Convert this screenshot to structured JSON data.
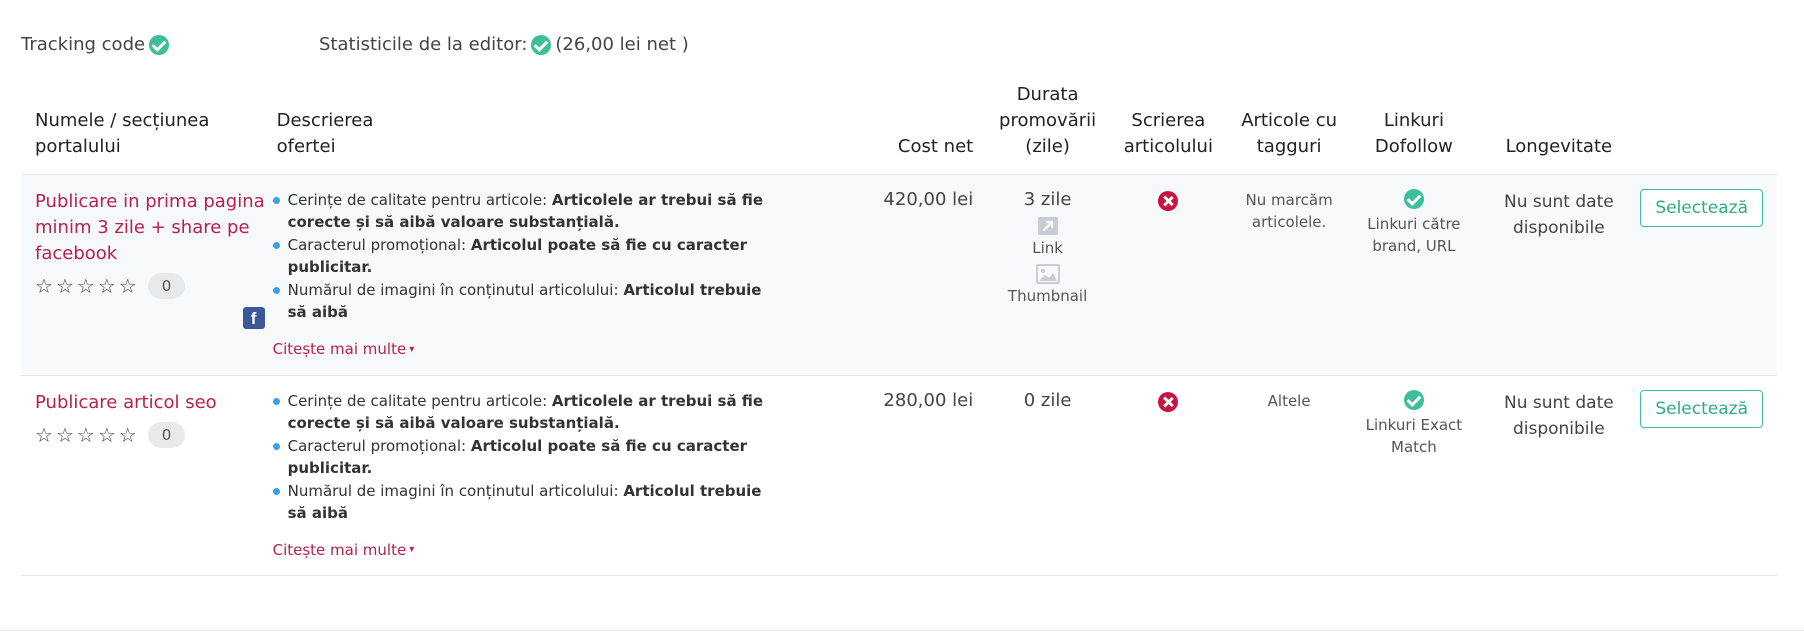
{
  "topbar": {
    "tracking_label": "Tracking code",
    "editor_stats_label": "Statisticile de la editor:",
    "editor_stats_value": "(26,00 lei net )"
  },
  "table": {
    "headers": {
      "name_l1": "Numele / secțiunea",
      "name_l2": "portalului",
      "desc_l1": "Descrierea",
      "desc_l2": "ofertei",
      "cost": "Cost net",
      "duration_l1": "Durata",
      "duration_l2": "promovării",
      "duration_l3": "(zile)",
      "writing_l1": "Scrierea",
      "writing_l2": "articolului",
      "tagged_l1": "Articole cu",
      "tagged_l2": "tagguri",
      "links_l1": "Linkuri",
      "links_l2": "Dofollow",
      "longevity": "Longevitate"
    },
    "rows": [
      {
        "portal_name": "Publicare in prima pagina minim 3 zile + share pe facebook",
        "rating_count": "0",
        "desc_1_label": "Cerințe de calitate pentru articole: ",
        "desc_1_value": "Articolele ar trebui să fie corecte și să aibă valoare substanțială.",
        "desc_2_label": "Caracterul promoțional: ",
        "desc_2_value": "Articolul poate să fie cu caracter publicitar.",
        "desc_3_label": "Numărul de imagini în conținutul articolului: ",
        "desc_3_value": "Articolul trebuie să aibă",
        "read_more": "Citește mai multe",
        "cost": "420,00 lei",
        "duration": "3 zile",
        "promo_link_label": "Link",
        "promo_thumb_label": "Thumbnail",
        "tagged": "Nu marcăm articolele.",
        "links": "Linkuri către brand, URL",
        "longevity": "Nu sunt date disponibile",
        "select_label": "Selectează"
      },
      {
        "portal_name": "Publicare articol seo",
        "rating_count": "0",
        "desc_1_label": "Cerințe de calitate pentru articole: ",
        "desc_1_value": "Articolele ar trebui să fie corecte și să aibă valoare substanțială.",
        "desc_2_label": "Caracterul promoțional: ",
        "desc_2_value": "Articolul poate să fie cu caracter publicitar.",
        "desc_3_label": "Numărul de imagini în conținutul articolului: ",
        "desc_3_value": "Articolul trebuie să aibă",
        "read_more": "Citește mai multe",
        "cost": "280,00 lei",
        "duration": "0 zile",
        "tagged": "Altele",
        "links": "Linkuri Exact Match",
        "longevity": "Nu sunt date disponibile",
        "select_label": "Selectează"
      }
    ]
  },
  "colors": {
    "link": "#b8204e",
    "success": "#3cbf9a",
    "error": "#c8153f",
    "bullet": "#3aa0e8",
    "facebook": "#3b5998"
  },
  "icons": {
    "tracking_status": "check-circle-icon",
    "editor_status": "check-circle-icon",
    "rating": "star-outline-icon",
    "facebook": "facebook-icon",
    "promo_link": "external-link-icon",
    "promo_thumbnail": "image-icon",
    "writing_status": "x-circle-icon",
    "dofollow_status": "check-circle-icon"
  }
}
